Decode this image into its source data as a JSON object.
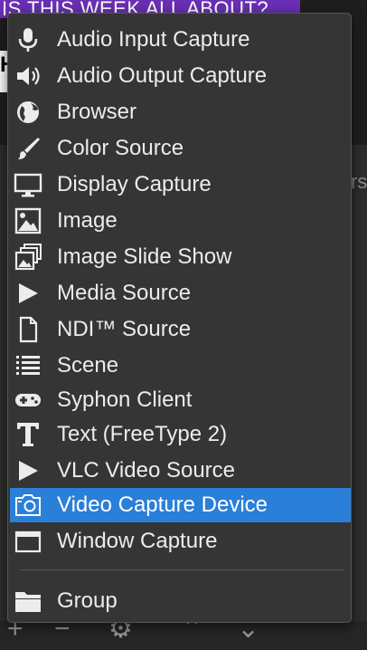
{
  "background": {
    "banner_text": "IS THIS WEEK ALL ABOUT?",
    "left_text": "H",
    "right_text": "rs"
  },
  "menu": {
    "items": [
      {
        "label": "Audio Input Capture",
        "icon": "microphone-icon"
      },
      {
        "label": "Audio Output Capture",
        "icon": "speaker-icon"
      },
      {
        "label": "Browser",
        "icon": "globe-icon"
      },
      {
        "label": "Color Source",
        "icon": "paintbrush-icon"
      },
      {
        "label": "Display Capture",
        "icon": "monitor-icon"
      },
      {
        "label": "Image",
        "icon": "image-icon"
      },
      {
        "label": "Image Slide Show",
        "icon": "slideshow-icon"
      },
      {
        "label": "Media Source",
        "icon": "play-icon"
      },
      {
        "label": "NDI™ Source",
        "icon": "file-icon"
      },
      {
        "label": "Scene",
        "icon": "list-icon"
      },
      {
        "label": "Syphon Client",
        "icon": "gamepad-icon"
      },
      {
        "label": "Text (FreeType 2)",
        "icon": "text-icon"
      },
      {
        "label": "VLC Video Source",
        "icon": "play-icon"
      },
      {
        "label": "Video Capture Device",
        "icon": "camera-icon",
        "selected": true
      },
      {
        "label": "Window Capture",
        "icon": "window-icon"
      }
    ],
    "group_item": {
      "label": "Group",
      "icon": "folder-icon"
    }
  },
  "colors": {
    "menu_background": "#353535",
    "selection": "#2a7fd8",
    "text": "#ececec"
  }
}
